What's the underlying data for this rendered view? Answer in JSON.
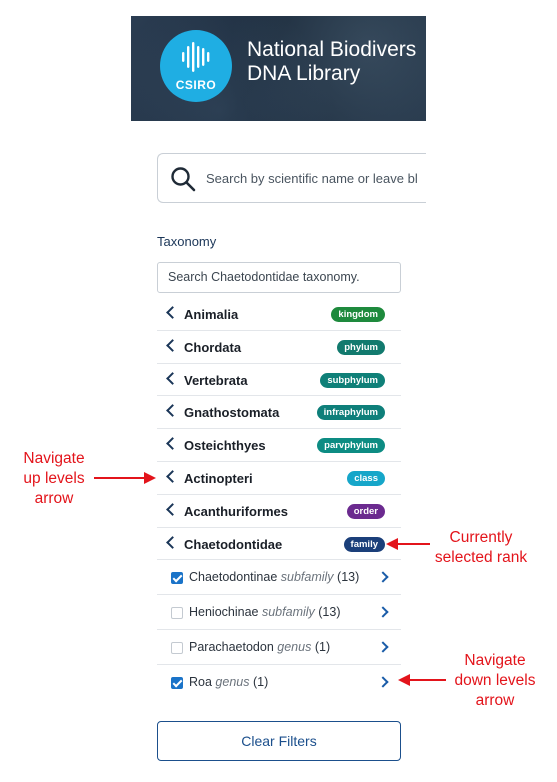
{
  "header": {
    "logo_text": "CSIRO",
    "title_line1": "National Biodivers",
    "title_line2": "DNA Library"
  },
  "search": {
    "placeholder": "Search by scientific name or leave bl"
  },
  "taxonomy": {
    "title": "Taxonomy",
    "search_placeholder": "Search Chaetodontidae taxonomy.",
    "ranks": [
      {
        "name": "Animalia",
        "rank": "kingdom",
        "color": "#1e8a3d"
      },
      {
        "name": "Chordata",
        "rank": "phylum",
        "color": "#127a6e"
      },
      {
        "name": "Vertebrata",
        "rank": "subphylum",
        "color": "#0f8078"
      },
      {
        "name": "Gnathostomata",
        "rank": "infraphylum",
        "color": "#0e7f7a"
      },
      {
        "name": "Osteichthyes",
        "rank": "parvphylum",
        "color": "#0d8c83"
      },
      {
        "name": "Actinopteri",
        "rank": "class",
        "color": "#16a6c9"
      },
      {
        "name": "Acanthuriformes",
        "rank": "order",
        "color": "#6b2a8f"
      },
      {
        "name": "Chaetodontidae",
        "rank": "family",
        "color": "#1b3f7a"
      }
    ],
    "children": [
      {
        "name": "Chaetodontinae",
        "rank": "subfamily",
        "count": "(13)",
        "checked": true
      },
      {
        "name": "Heniochinae",
        "rank": "subfamily",
        "count": "(13)",
        "checked": false
      },
      {
        "name": "Parachaetodon",
        "rank": "genus",
        "count": "(1)",
        "checked": false
      },
      {
        "name": "Roa",
        "rank": "genus",
        "count": "(1)",
        "checked": true
      }
    ]
  },
  "clear_button": "Clear Filters",
  "annotations": {
    "up_line1": "Navigate",
    "up_line2": "up levels",
    "up_line3": "arrow",
    "selected_line1": "Currently",
    "selected_line2": "selected rank",
    "down_line1": "Navigate",
    "down_line2": "down levels",
    "down_line3": "arrow",
    "color": "#e3141b"
  }
}
